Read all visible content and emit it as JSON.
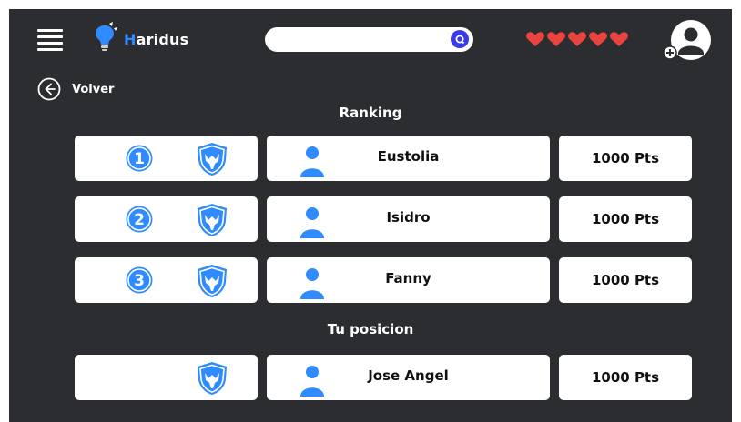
{
  "header": {
    "app_name_first_letter": "H",
    "app_name_rest": "aridus",
    "search": {
      "placeholder": "",
      "value": ""
    },
    "lives_count": 5,
    "accent_color": "#2f8bff"
  },
  "nav": {
    "back_label": "Volver"
  },
  "ranking": {
    "title": "Ranking",
    "rows": [
      {
        "position": "1",
        "name": "Eustolia",
        "points": "1000 Pts"
      },
      {
        "position": "2",
        "name": "Isidro",
        "points": "1000 Pts"
      },
      {
        "position": "3",
        "name": "Fanny",
        "points": "1000 Pts"
      }
    ]
  },
  "my_position": {
    "title": "Tu posicion",
    "name": "Jose Angel",
    "points": "1000 Pts"
  },
  "icons": [
    "menu-icon",
    "lightbulb-icon",
    "search-icon",
    "heart-icon",
    "user-add-icon",
    "back-arrow-icon",
    "rank-number-icon",
    "shield-eagle-icon",
    "person-icon"
  ]
}
